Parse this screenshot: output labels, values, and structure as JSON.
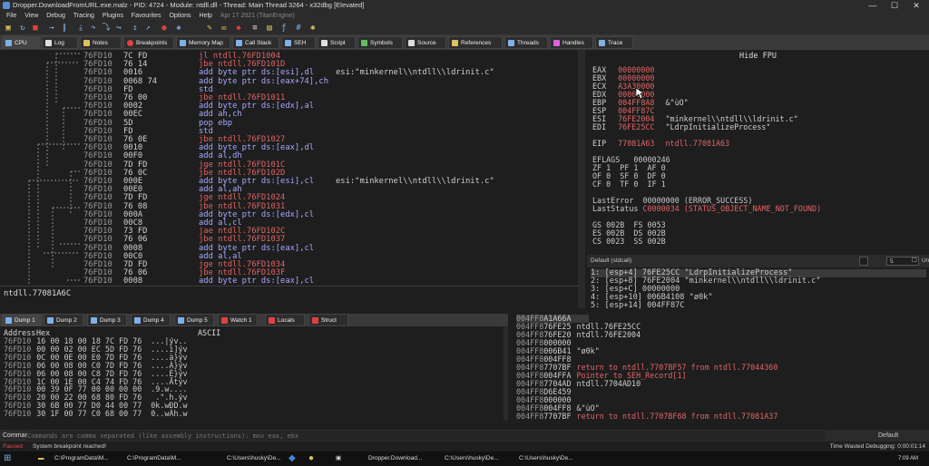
{
  "window": {
    "title": "Dropper.DownloadFromURL.exe.malz - PID: 4724 - Module: ntdll.dll - Thread: Main Thread 3264 - x32dbg [Elevated]",
    "min": "—",
    "max": "☐",
    "close": "✕"
  },
  "menu": {
    "items": [
      "File",
      "View",
      "Debug",
      "Tracing",
      "Plugins",
      "Favourites",
      "Options",
      "Help"
    ],
    "date": "Apr 17 2021 (TitanEngine)"
  },
  "tabs": [
    {
      "label": "CPU",
      "color": "#7fb1e8"
    },
    {
      "label": "Log",
      "color": "#dddddd"
    },
    {
      "label": "Notes",
      "color": "#e0c060"
    },
    {
      "label": "Breakpoints",
      "color": "#e04040"
    },
    {
      "label": "Memory Map",
      "color": "#7fb1e8"
    },
    {
      "label": "Call Stack",
      "color": "#7fb1e8"
    },
    {
      "label": "SEH",
      "color": "#7fb1e8"
    },
    {
      "label": "Script",
      "color": "#dddddd"
    },
    {
      "label": "Symbols",
      "color": "#60c060"
    },
    {
      "label": "Source",
      "color": "#dddddd"
    },
    {
      "label": "References",
      "color": "#e0c060"
    },
    {
      "label": "Threads",
      "color": "#7fb1e8"
    },
    {
      "label": "Handles",
      "color": "#e060e0"
    },
    {
      "label": "Trace",
      "color": "#7fb1e8"
    }
  ],
  "disasm": [
    {
      "addr": "76FD10",
      "bytes": "7C FD",
      "ins": "jl ntdll.76FD1004",
      "kind": "jmp",
      "cmt": ""
    },
    {
      "addr": "76FD10",
      "bytes": "76 14",
      "ins": "jbe ntdll.76FD101D",
      "kind": "jmp",
      "cmt": ""
    },
    {
      "addr": "76FD10",
      "bytes": "0016",
      "ins": "add byte ptr ds:[esi],dl",
      "kind": "oth",
      "cmt": "esi:\"minkernel\\\\ntdll\\\\ldrinit.c\""
    },
    {
      "addr": "76FD10",
      "bytes": "0068 74",
      "ins": "add byte ptr ds:[eax+74],ch",
      "kind": "oth",
      "cmt": ""
    },
    {
      "addr": "76FD10",
      "bytes": "FD",
      "ins": "std",
      "kind": "oth",
      "cmt": ""
    },
    {
      "addr": "76FD10",
      "bytes": "76 00",
      "ins": "jbe ntdll.76FD1011",
      "kind": "jmp",
      "cmt": ""
    },
    {
      "addr": "76FD10",
      "bytes": "0002",
      "ins": "add byte ptr ds:[edx],al",
      "kind": "oth",
      "cmt": ""
    },
    {
      "addr": "76FD10",
      "bytes": "00EC",
      "ins": "add ah,ch",
      "kind": "oth",
      "cmt": ""
    },
    {
      "addr": "76FD10",
      "bytes": "5D",
      "ins": "pop ebp",
      "kind": "oth",
      "cmt": ""
    },
    {
      "addr": "76FD10",
      "bytes": "FD",
      "ins": "std",
      "kind": "oth",
      "cmt": ""
    },
    {
      "addr": "76FD10",
      "bytes": "76 0E",
      "ins": "jbe ntdll.76FD1027",
      "kind": "jmp",
      "cmt": ""
    },
    {
      "addr": "76FD10",
      "bytes": "0010",
      "ins": "add byte ptr ds:[eax],dl",
      "kind": "oth",
      "cmt": ""
    },
    {
      "addr": "76FD10",
      "bytes": "00F0",
      "ins": "add al,dh",
      "kind": "oth",
      "cmt": ""
    },
    {
      "addr": "76FD10",
      "bytes": "7D FD",
      "ins": "jge ntdll.76FD101C",
      "kind": "jmp",
      "cmt": ""
    },
    {
      "addr": "76FD10",
      "bytes": "76 0C",
      "ins": "jbe ntdll.76FD102D",
      "kind": "jmp",
      "cmt": ""
    },
    {
      "addr": "76FD10",
      "bytes": "000E",
      "ins": "add byte ptr ds:[esi],cl",
      "kind": "oth",
      "cmt": "esi:\"minkernel\\\\ntdll\\\\ldrinit.c\""
    },
    {
      "addr": "76FD10",
      "bytes": "00E0",
      "ins": "add al,ah",
      "kind": "oth",
      "cmt": ""
    },
    {
      "addr": "76FD10",
      "bytes": "7D FD",
      "ins": "jge ntdll.76FD1024",
      "kind": "jmp",
      "cmt": ""
    },
    {
      "addr": "76FD10",
      "bytes": "76 08",
      "ins": "jbe ntdll.76FD1031",
      "kind": "jmp",
      "cmt": ""
    },
    {
      "addr": "76FD10",
      "bytes": "000A",
      "ins": "add byte ptr ds:[edx],cl",
      "kind": "oth",
      "cmt": ""
    },
    {
      "addr": "76FD10",
      "bytes": "00C8",
      "ins": "add al,cl",
      "kind": "oth",
      "cmt": ""
    },
    {
      "addr": "76FD10",
      "bytes": "73 FD",
      "ins": "jae ntdll.76FD102C",
      "kind": "jmp",
      "cmt": ""
    },
    {
      "addr": "76FD10",
      "bytes": "76 06",
      "ins": "jbe ntdll.76FD1037",
      "kind": "jmp",
      "cmt": ""
    },
    {
      "addr": "76FD10",
      "bytes": "0008",
      "ins": "add byte ptr ds:[eax],cl",
      "kind": "oth",
      "cmt": ""
    },
    {
      "addr": "76FD10",
      "bytes": "00C0",
      "ins": "add al,al",
      "kind": "oth",
      "cmt": ""
    },
    {
      "addr": "76FD10",
      "bytes": "7D FD",
      "ins": "jge ntdll.76FD1034",
      "kind": "jmp",
      "cmt": ""
    },
    {
      "addr": "76FD10",
      "bytes": "76 06",
      "ins": "jbe ntdll.76FD103F",
      "kind": "jmp",
      "cmt": ""
    },
    {
      "addr": "76FD10",
      "bytes": "0008",
      "ins": "add byte ptr ds:[eax],cl",
      "kind": "oth",
      "cmt": ""
    }
  ],
  "infobar": {
    "text": "ntdll.77081A6C"
  },
  "registers": {
    "hide_fpu": "Hide FPU",
    "lines": [
      [
        "EAX",
        "00000000",
        ""
      ],
      [
        "EBX",
        "00000000",
        ""
      ],
      [
        "ECX",
        "A3A30000",
        ""
      ],
      [
        "EDX",
        "00000000",
        ""
      ],
      [
        "EBP",
        "004FF8A8",
        "&\"ùO\""
      ],
      [
        "ESP",
        "004FF87C",
        ""
      ],
      [
        "ESI",
        "76FE2004",
        "\"minkernel\\\\ntdll\\\\ldrinit.c\""
      ],
      [
        "EDI",
        "76FE25CC",
        "\"LdrpInitializeProcess\""
      ],
      [
        "",
        "",
        " "
      ],
      [
        "EIP",
        "77081A63",
        "ntdll.77081A63"
      ]
    ],
    "eflags": "EFLAGS   00000246",
    "flags": [
      "ZF 1  PF 1  AF 0",
      "OF 0  SF 0  DF 0",
      "CF 0  TF 0  IF 1"
    ],
    "lasterror": "LastError  00000000 (ERROR_SUCCESS)",
    "laststatus_label": "LastStatus ",
    "laststatus_val": "C0000034 (STATUS_OBJECT_NAME_NOT_FOUND)",
    "segs": [
      "GS 002B  FS 0053",
      "ES 002B  DS 002B",
      "CS 0023  SS 002B"
    ]
  },
  "callconv": {
    "selected": "Default (stdcall)",
    "count": "5",
    "unlocked": "Unlocked"
  },
  "stackargs": [
    "1: [esp+4] 76FE25CC \"LdrpInitializeProcess\"",
    "2: [esp+8] 76FE2004 \"minkernel\\\\ntdll\\\\ldrinit.c\"",
    "3: [esp+C] 00000000",
    "4: [esp+10] 006B4108 \"ø0k\"",
    "5: [esp+14] 004FF87C"
  ],
  "dumptabs": [
    "Dump 1",
    "Dump 2",
    "Dump 3",
    "Dump 4",
    "Dump 5",
    "Watch 1",
    "Locals",
    "Struct"
  ],
  "dump": {
    "headers": [
      "Address",
      "Hex",
      "ASCII"
    ],
    "rows": [
      [
        "76FD10",
        "16 00 18 00 18 7C FD 76",
        "...|ýv.."
      ],
      [
        "76FD10",
        "00 00 02 00 EC 5D FD 76",
        "....ì]ýv"
      ],
      [
        "76FD10",
        "0C 00 0E 00 E0 7D FD 76",
        "....à}ýv"
      ],
      [
        "76FD10",
        "06 00 08 00 C0 7D FD 76",
        "....À}ýv"
      ],
      [
        "76FD10",
        "06 00 08 00 C8 7D FD 76",
        "....È}ýv"
      ],
      [
        "76FD10",
        "1C 00 1E 00 C4 74 FD 76",
        "....Ätýv"
      ],
      [
        "76FD10",
        "00 39 0F 77 00 00 00 00",
        ".9.w...."
      ],
      [
        "76FD10",
        "20 00 22 00 68 80 FD 76",
        " .\".h.ýv"
      ],
      [
        "76FD10",
        "30 6B 00 77 D0 44 00 77",
        "0k.wÐD.w"
      ],
      [
        "76FD10",
        "30 1F 00 77 C0 68 00 77",
        "0..wÀh.w"
      ]
    ]
  },
  "stack": [
    [
      "004FF8",
      "A1A66A",
      ""
    ],
    [
      "004FF8",
      "76FE25",
      ""
    ],
    [
      "004FF8",
      "76FE20",
      ""
    ],
    [
      "004FF8",
      "000000",
      ""
    ],
    [
      "004FF8",
      "006B41",
      ""
    ],
    [
      "004FF8",
      "004FF8",
      ""
    ],
    [
      "004FF8",
      "7707BF",
      "return to ntdll.7707BF57 from ntdll.77044360"
    ],
    [
      "004FF8",
      "004FFA",
      "Pointer to SEH_Record[1]"
    ],
    [
      "004FF8",
      "7704AD",
      "ntdll.7704AD10"
    ],
    [
      "004FF8",
      "D6E459",
      ""
    ],
    [
      "004FF8",
      "000000",
      ""
    ],
    [
      "004FF8",
      "004FF8",
      "&\"ùO\""
    ],
    [
      "004FF8",
      "7707BF",
      "return to ntdll.7707BF68 from ntdll.77081A37"
    ]
  ],
  "stackinline": [
    "ntdll.76FE25CC",
    "ntdll.76FE2004",
    "",
    "\"ø0k\""
  ],
  "cmd": {
    "label": "Command:",
    "placeholder": "Commands are comma separated (like assembly instructions): mov eax, ebx",
    "mode": "Default"
  },
  "status": {
    "state": "Paused",
    "message": "System breakpoint reached!",
    "time": "Time Wasted Debugging: 0:00:01:14"
  },
  "taskbar": {
    "items": [
      "C:\\ProgramData\\M...",
      "C:\\ProgramData\\M...",
      "C:\\Users\\husky\\De...",
      "",
      "",
      "",
      "Dropper.Download...",
      "C:\\Users\\husky\\De...",
      "C:\\Users\\husky\\De..."
    ],
    "clock": "7:09 AM"
  },
  "cursor": "mouse-pointer-icon"
}
